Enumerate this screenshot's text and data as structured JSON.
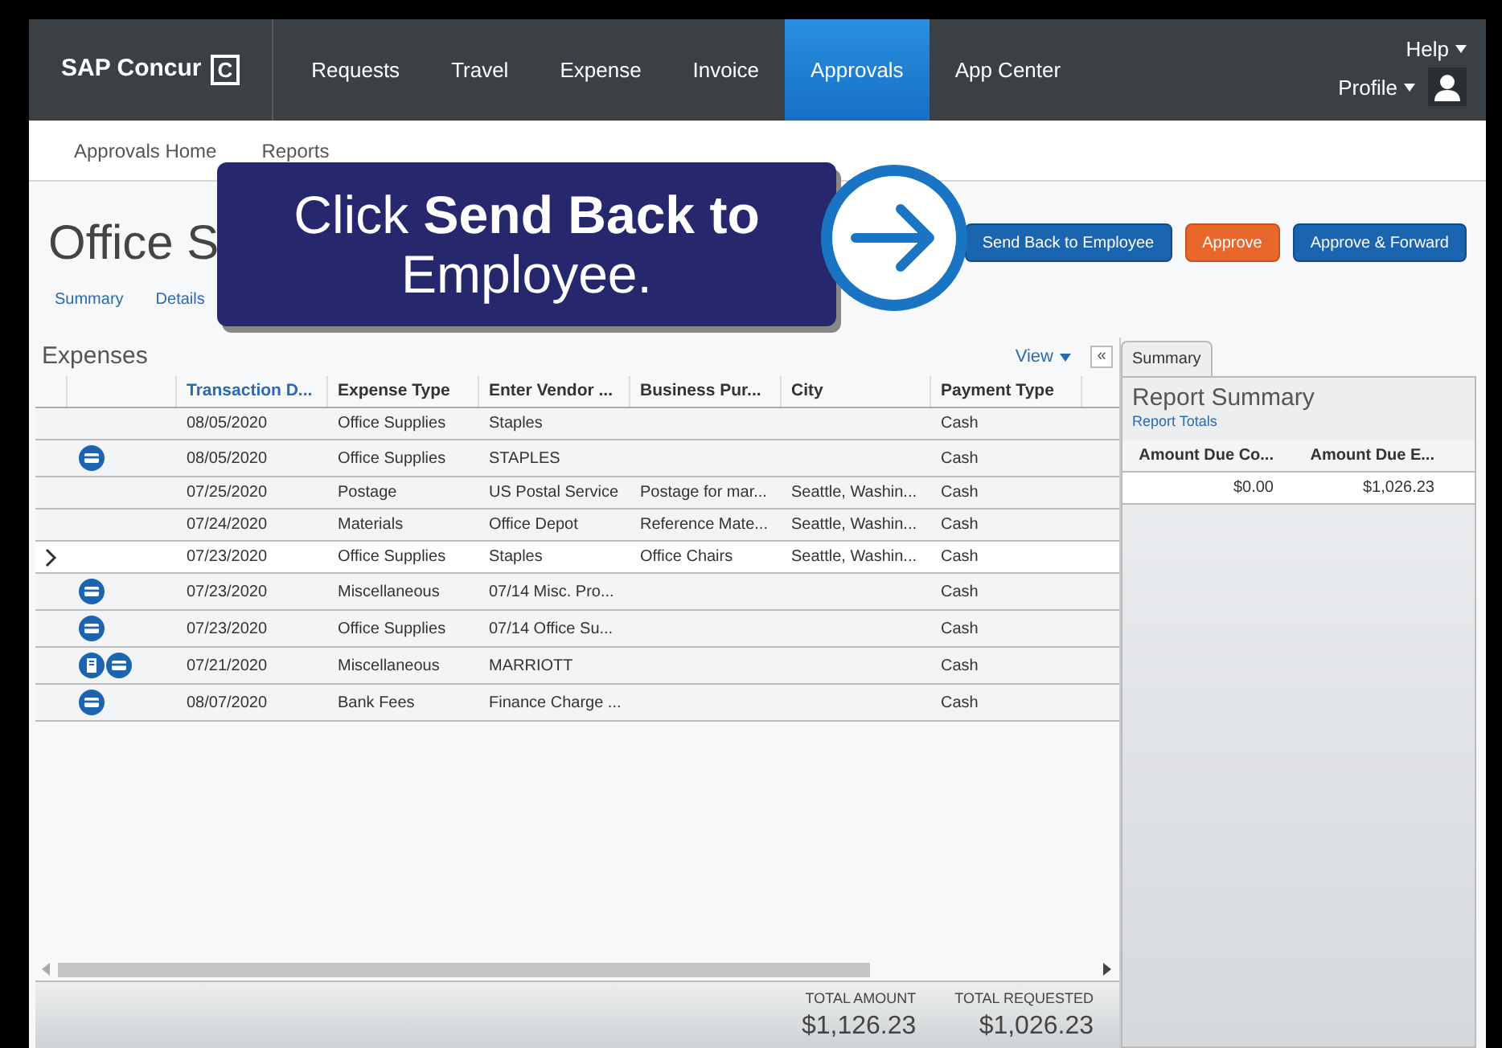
{
  "nav": {
    "logo": "SAP Concur",
    "logo_mark": "C",
    "tabs": [
      {
        "label": "Requests",
        "selected": false
      },
      {
        "label": "Travel",
        "selected": false
      },
      {
        "label": "Expense",
        "selected": false
      },
      {
        "label": "Invoice",
        "selected": false
      },
      {
        "label": "Approvals",
        "selected": true
      },
      {
        "label": "App Center",
        "selected": false
      }
    ],
    "help": "Help",
    "profile": "Profile"
  },
  "subnav": [
    "Approvals Home",
    "Reports"
  ],
  "report": {
    "title": "Office S",
    "links": [
      "Summary",
      "Details"
    ]
  },
  "callout": {
    "text": "Click **Send Back to** Employee."
  },
  "actions": [
    {
      "label": "Send Back to Employee",
      "kind": "primary"
    },
    {
      "label": "Approve",
      "kind": "accent"
    },
    {
      "label": "Approve & Forward",
      "kind": "primary"
    }
  ],
  "expenses": {
    "title": "Expenses",
    "view": "View",
    "collapse": "«",
    "columns": [
      "Transaction D...",
      "Expense Type",
      "Enter Vendor ...",
      "Business Pur...",
      "City",
      "Payment Type"
    ],
    "rows": [
      {
        "current": false,
        "receipt": false,
        "card": false,
        "cells": [
          "08/05/2020",
          "Office Supplies",
          "Staples",
          "",
          "",
          "Cash"
        ]
      },
      {
        "current": false,
        "receipt": false,
        "card": true,
        "cells": [
          "08/05/2020",
          "Office Supplies",
          "STAPLES",
          "",
          "",
          "Cash"
        ]
      },
      {
        "current": false,
        "receipt": false,
        "card": false,
        "cells": [
          "07/25/2020",
          "Postage",
          "US Postal Service",
          "Postage for mar...",
          "Seattle, Washin...",
          "Cash"
        ]
      },
      {
        "current": false,
        "receipt": false,
        "card": false,
        "cells": [
          "07/24/2020",
          "Materials",
          "Office Depot",
          "Reference Mate...",
          "Seattle, Washin...",
          "Cash"
        ]
      },
      {
        "current": true,
        "receipt": false,
        "card": false,
        "cells": [
          "07/23/2020",
          "Office Supplies",
          "Staples",
          "Office Chairs",
          "Seattle, Washin...",
          "Cash"
        ]
      },
      {
        "current": false,
        "receipt": false,
        "card": true,
        "cells": [
          "07/23/2020",
          "Miscellaneous",
          "07/14 Misc. Pro...",
          "",
          "",
          "Cash"
        ]
      },
      {
        "current": false,
        "receipt": false,
        "card": true,
        "cells": [
          "07/23/2020",
          "Office Supplies",
          "07/14 Office Su...",
          "",
          "",
          "Cash"
        ]
      },
      {
        "current": false,
        "receipt": true,
        "card": true,
        "cells": [
          "07/21/2020",
          "Miscellaneous",
          "MARRIOTT",
          "",
          "",
          "Cash"
        ]
      },
      {
        "current": false,
        "receipt": false,
        "card": true,
        "cells": [
          "08/07/2020",
          "Bank Fees",
          "Finance Charge ...",
          "",
          "",
          "Cash"
        ]
      }
    ],
    "totals": [
      {
        "label": "TOTAL AMOUNT",
        "value": "$1,126.23"
      },
      {
        "label": "TOTAL REQUESTED",
        "value": "$1,026.23"
      }
    ]
  },
  "summary": {
    "tab": "Summary",
    "title": "Report Summary",
    "subtitle": "Report Totals",
    "columns": [
      "Amount Due Co...",
      "Amount Due E..."
    ],
    "values": [
      "$0.00",
      "$1,026.23"
    ]
  }
}
